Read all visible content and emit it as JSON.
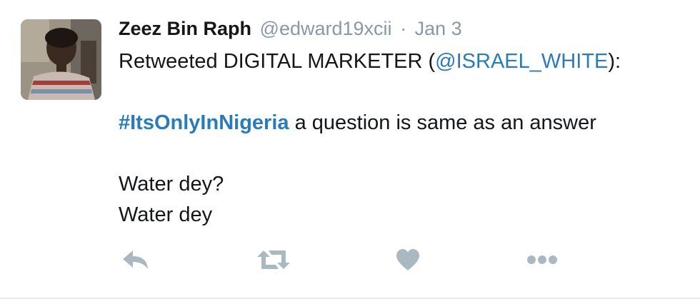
{
  "tweet": {
    "fullname": "Zeez Bin Raph",
    "username": "@edward19xcii",
    "separator": "·",
    "time": "Jan 3",
    "retweet_prefix": "Retweeted DIGITAL MARKETER (",
    "mention": "@ISRAEL_WHITE",
    "retweet_suffix": "):",
    "hashtag": "#ItsOnlyInNigeria",
    "line_text": " a question is same as an answer",
    "line_3": "Water dey?",
    "line_4": "Water dey"
  },
  "icons": {
    "reply": "reply-icon",
    "retweet": "retweet-icon",
    "like": "heart-icon",
    "more": "more-dots-icon"
  },
  "colors": {
    "link": "#2b7bb9",
    "meta": "#8899a6",
    "icon": "#aab8c2",
    "text": "#14171a"
  }
}
